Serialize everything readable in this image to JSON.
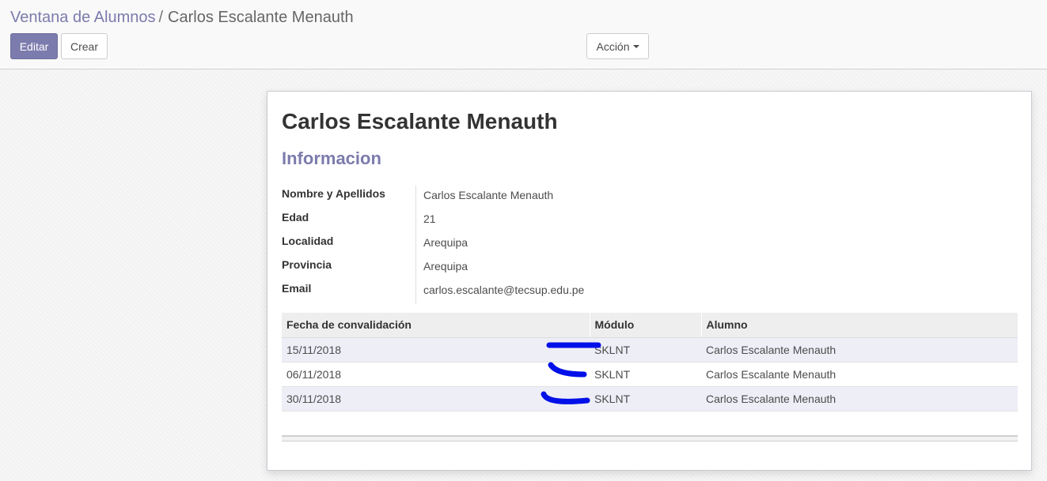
{
  "breadcrumb": {
    "parent": "Ventana de Alumnos",
    "separator": "/",
    "current": "Carlos Escalante Menauth"
  },
  "buttons": {
    "edit": "Editar",
    "create": "Crear",
    "action": "Acción"
  },
  "record": {
    "title": "Carlos Escalante Menauth",
    "section": "Informacion",
    "fields": [
      {
        "label": "Nombre y Apellidos",
        "value": "Carlos Escalante Menauth"
      },
      {
        "label": "Edad",
        "value": "21"
      },
      {
        "label": "Localidad",
        "value": "Arequipa"
      },
      {
        "label": "Provincia",
        "value": "Arequipa"
      },
      {
        "label": "Email",
        "value": "carlos.escalante@tecsup.edu.pe"
      }
    ]
  },
  "table": {
    "headers": [
      "Fecha de convalidación",
      "Módulo",
      "Alumno"
    ],
    "rows": [
      [
        "15/11/2018",
        "SKLNT",
        "Carlos Escalante Menauth"
      ],
      [
        "06/11/2018",
        "SKLNT",
        "Carlos Escalante Menauth"
      ],
      [
        "30/11/2018",
        "SKLNT",
        "Carlos Escalante Menauth"
      ]
    ]
  },
  "colors": {
    "accent": "#7c7bad",
    "scribble": "#0010e8"
  }
}
